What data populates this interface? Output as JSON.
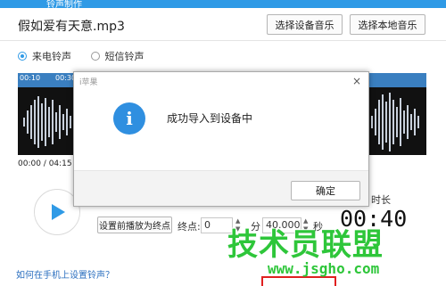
{
  "window": {
    "title": "铃声制作"
  },
  "header": {
    "song_title": "假如爱有天意.mp3",
    "select_device_music": "选择设备音乐",
    "select_local_music": "选择本地音乐"
  },
  "ringtone_type": {
    "options": [
      {
        "label": "来电铃声",
        "selected": true
      },
      {
        "label": "短信铃声",
        "selected": false
      }
    ]
  },
  "waveform": {
    "ruler_labels": [
      "00:10",
      "00:30"
    ],
    "current_total": "00:00 / 04:15"
  },
  "controls": {
    "set_end_button": "设置前播放为终点",
    "end_label": "终点:",
    "end_minutes": "0",
    "minute_unit": "分",
    "end_seconds": "40.000",
    "second_unit": "秒",
    "duration_label": "时长",
    "duration_value": "00:40"
  },
  "footer": {
    "help_link": "如何在手机上设置铃声？"
  },
  "dialog": {
    "title": "i苹果",
    "message": "成功导入到设备中",
    "ok_label": "确定",
    "close_glyph": "×"
  },
  "watermark": {
    "text": "技术员联盟",
    "url": "www.jsgho.com"
  },
  "colors": {
    "accent": "#2f9ae6",
    "dialog_icon": "#2f8fe0",
    "watermark": "#2ec63a"
  }
}
